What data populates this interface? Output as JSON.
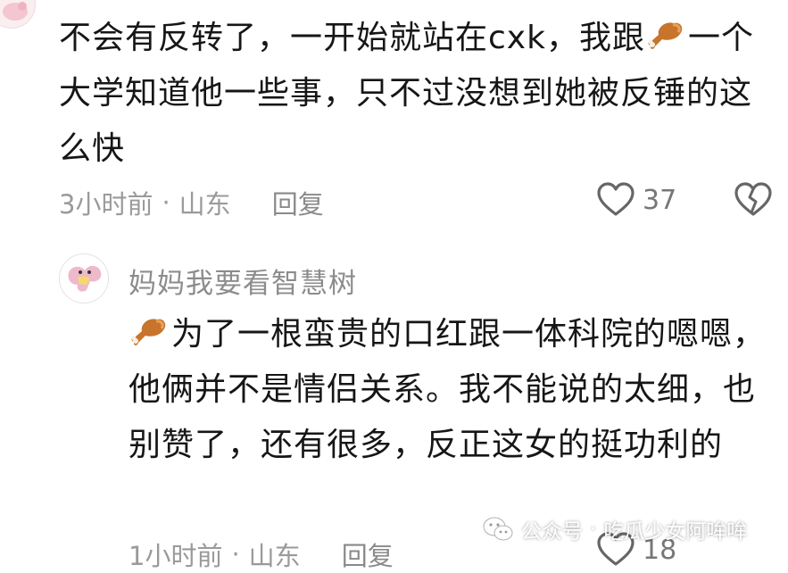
{
  "comment1": {
    "text_a": "不会有反转了，一开始就站在cxk，我跟",
    "emoji": "drumstick-emoji",
    "text_b": "一个大学知道他一些事，只不过没想到她被反锤的这么快",
    "time": "3小时前",
    "separator": "·",
    "location": "山东",
    "reply_label": "回复",
    "like_count": "37"
  },
  "comment2": {
    "username": "妈妈我要看智慧树",
    "emoji": "drumstick-emoji",
    "text": "为了一根蛮贵的口红跟一体科院的嗯嗯，他俩并不是情侣关系。我不能说的太细，也别赞了，还有很多，反正这女的挺功利的",
    "time": "1小时前",
    "separator": "·",
    "location": "山东",
    "reply_label": "回复",
    "like_count": "18"
  },
  "watermark": {
    "platform": "公众号",
    "separator": "·",
    "account": "吃瓜少女阿哞哞"
  },
  "colors": {
    "text": "#161616",
    "meta": "#9a9a9a",
    "background": "#ffffff"
  }
}
